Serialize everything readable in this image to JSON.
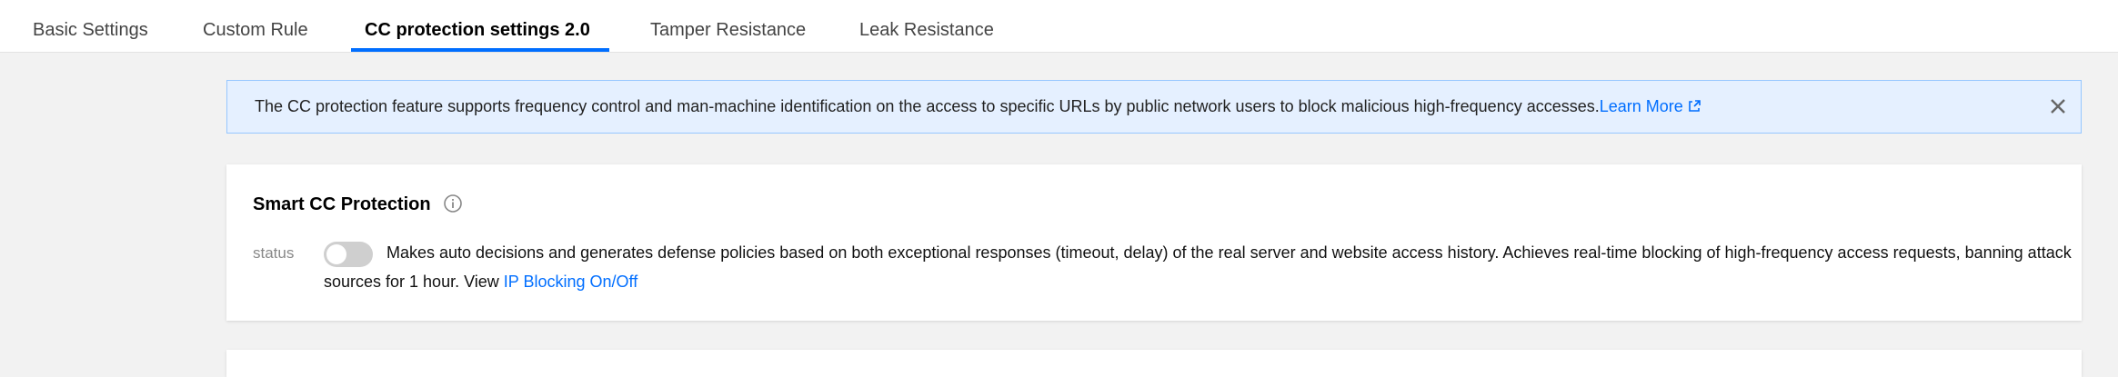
{
  "tabs": [
    {
      "label": "Basic Settings",
      "active": false
    },
    {
      "label": "Custom Rule",
      "active": false
    },
    {
      "label": "CC protection settings 2.0",
      "active": true
    },
    {
      "label": "Tamper Resistance",
      "active": false
    },
    {
      "label": "Leak Resistance",
      "active": false
    }
  ],
  "notice": {
    "text": "The CC protection feature supports frequency control and man-machine identification on the access to specific URLs by public network users to block malicious high-frequency accesses.",
    "link_label": "Learn More",
    "link_icon": "external-link-icon",
    "close_icon": "close-icon"
  },
  "smart_cc": {
    "title": "Smart CC Protection",
    "info_icon": "info-icon",
    "status_label": "status",
    "toggle_on": false,
    "description_line1": "Makes auto decisions and generates defense policies based on both exceptional responses (timeout, delay) of the real server and website access history. Achieves real-time blocking of high-frequency access requests, banning attack",
    "description_line2_prefix": "sources for 1 hour. View ",
    "description_link": "IP Blocking On/Off"
  },
  "colors": {
    "accent": "#006eff",
    "notice_bg": "#e5f0ff",
    "notice_border": "#97c7ff",
    "page_bg": "#f2f2f2",
    "toggle_off": "#cfcfcf"
  }
}
